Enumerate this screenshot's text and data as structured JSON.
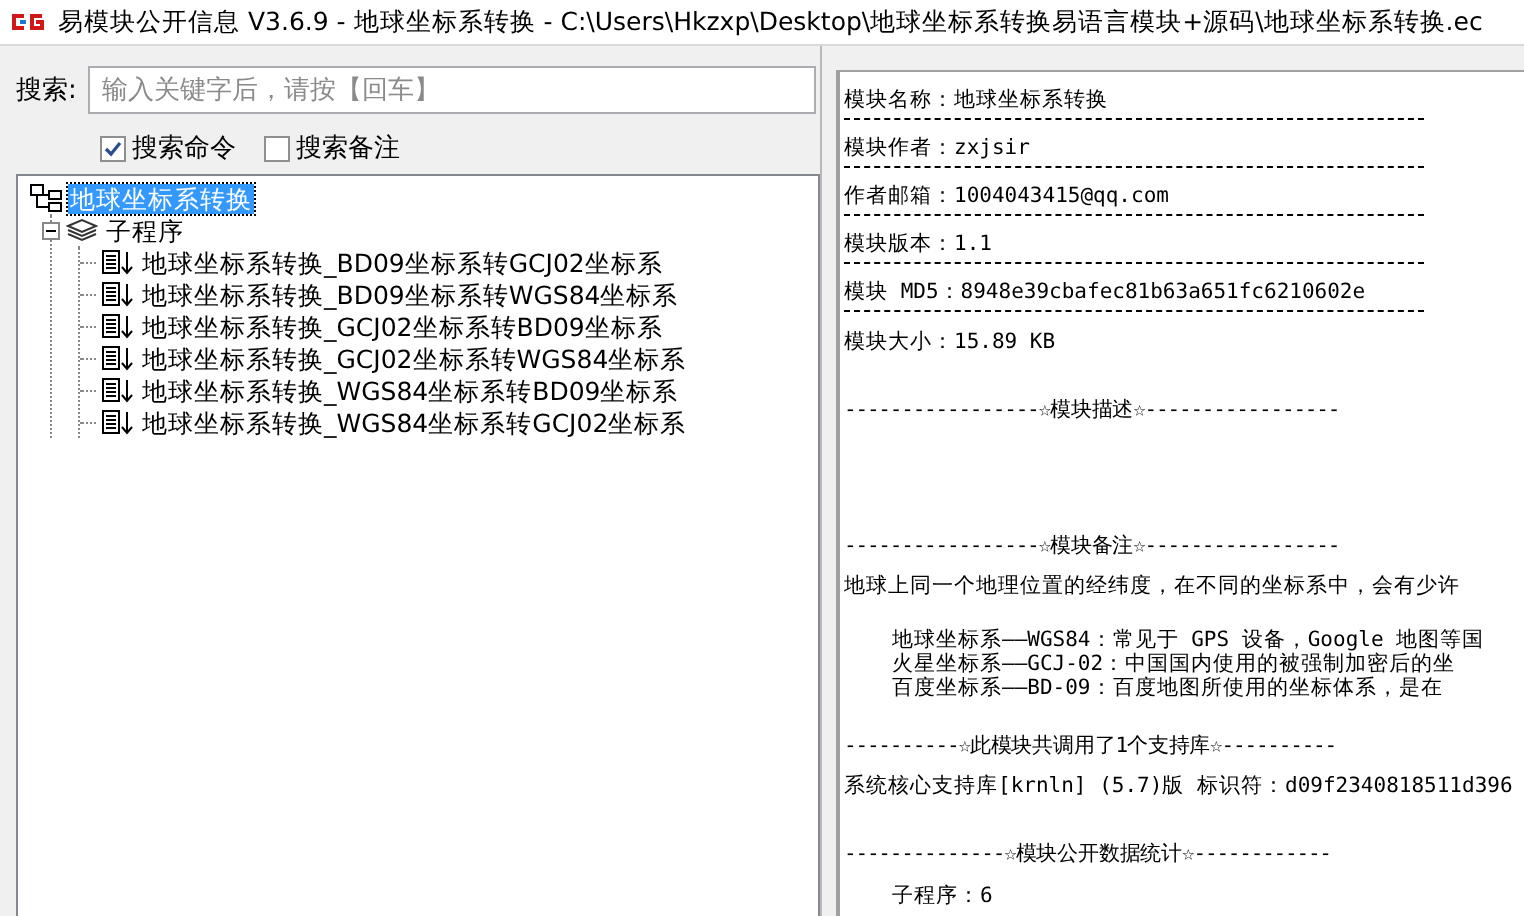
{
  "window": {
    "title": "易模块公开信息 V3.6.9 - 地球坐标系转换 - C:\\Users\\Hkzxp\\Desktop\\地球坐标系转换易语言模块+源码\\地球坐标系转换.ec"
  },
  "search": {
    "label": "搜索:",
    "placeholder": "输入关键字后，请按【回车】"
  },
  "options": [
    {
      "label": "搜索命令",
      "checked": true
    },
    {
      "label": "搜索备注",
      "checked": false
    }
  ],
  "tree": {
    "label": "地球坐标系转换",
    "selected": true,
    "children": [
      {
        "label": "子程序",
        "selected": false,
        "expanded": true,
        "children": [
          {
            "label": "地球坐标系转换_BD09坐标系转GCJ02坐标系",
            "selected": false
          },
          {
            "label": "地球坐标系转换_BD09坐标系转WGS84坐标系",
            "selected": false
          },
          {
            "label": "地球坐标系转换_GCJ02坐标系转BD09坐标系",
            "selected": false
          },
          {
            "label": "地球坐标系转换_GCJ02坐标系转WGS84坐标系",
            "selected": false
          },
          {
            "label": "地球坐标系转换_WGS84坐标系转BD09坐标系",
            "selected": false
          },
          {
            "label": "地球坐标系转换_WGS84坐标系转GCJ02坐标系",
            "selected": false
          }
        ]
      }
    ]
  },
  "info": [
    {
      "kind": "field",
      "text": "模块名称：地球坐标系转换"
    },
    {
      "kind": "field",
      "text": "模块作者：zxjsir"
    },
    {
      "kind": "field",
      "text": "作者邮箱：1004043415@qq.com"
    },
    {
      "kind": "field",
      "text": "模块版本：1.1"
    },
    {
      "kind": "field",
      "text": "模块 MD5：8948e39cbafec81b63a651fc6210602e"
    },
    {
      "kind": "text",
      "text": "模块大小：15.89 KB"
    },
    {
      "kind": "heading",
      "text": "-----------------☆模块描述☆-----------------"
    },
    {
      "kind": "heading",
      "text": "-----------------☆模块备注☆-----------------"
    },
    {
      "kind": "text",
      "text": "地球上同一个地理位置的经纬度，在不同的坐标系中，会有少许"
    },
    {
      "kind": "indent",
      "text": "地球坐标系——WGS84：常见于 GPS 设备，Google 地图等国"
    },
    {
      "kind": "indent",
      "text": "火星坐标系——GCJ-02：中国国内使用的被强制加密后的坐"
    },
    {
      "kind": "indent",
      "text": "百度坐标系——BD-09：百度地图所使用的坐标体系，是在"
    },
    {
      "kind": "heading",
      "text": "----------☆此模块共调用了1个支持库☆----------"
    },
    {
      "kind": "text",
      "text": "系统核心支持库[krnln] (5.7)版 标识符：d09f2340818511d396"
    },
    {
      "kind": "heading",
      "text": "--------------☆模块公开数据统计☆------------"
    },
    {
      "kind": "indent",
      "text": "子程序：6"
    }
  ]
}
